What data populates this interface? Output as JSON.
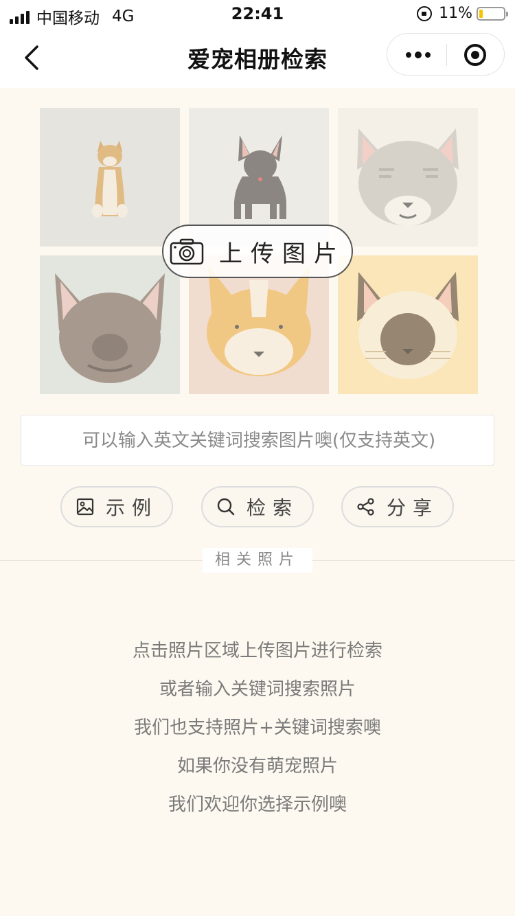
{
  "status_bar": {
    "carrier": "中国移动",
    "network": "4G",
    "time": "22:41",
    "battery": "11%",
    "icons": [
      "signal-icon",
      "orientation-lock-icon",
      "battery-icon"
    ]
  },
  "navbar": {
    "title": "爱宠相册检索",
    "icons": [
      "back-icon",
      "more-icon",
      "close-miniprogram-icon"
    ]
  },
  "photo_area": {
    "tiles": [
      "shiba-dog",
      "chihuahua",
      "tabby-cat",
      "french-bulldog",
      "corgi",
      "siamese-cat"
    ],
    "upload_label": "上传图片",
    "icon": "camera-icon"
  },
  "search": {
    "placeholder": "可以输入英文关键词搜索图片噢(仅支持英文)"
  },
  "actions": {
    "example_label": "示例",
    "search_label": "检索",
    "share_label": "分享"
  },
  "section": {
    "title": "相关照片"
  },
  "hints": [
    "点击照片区域上传图片进行检索",
    "或者输入关键词搜索照片",
    "我们也支持照片+关键词搜索噢",
    "如果你没有萌宠照片",
    "我们欢迎你选择示例噢"
  ],
  "colors": {
    "page_bg": "#fdf8f0",
    "tile_bg_gray": "#e5e4df",
    "tile_bg_peach": "#f3ddd1",
    "tile_bg_yellow": "#fbe7bb"
  }
}
